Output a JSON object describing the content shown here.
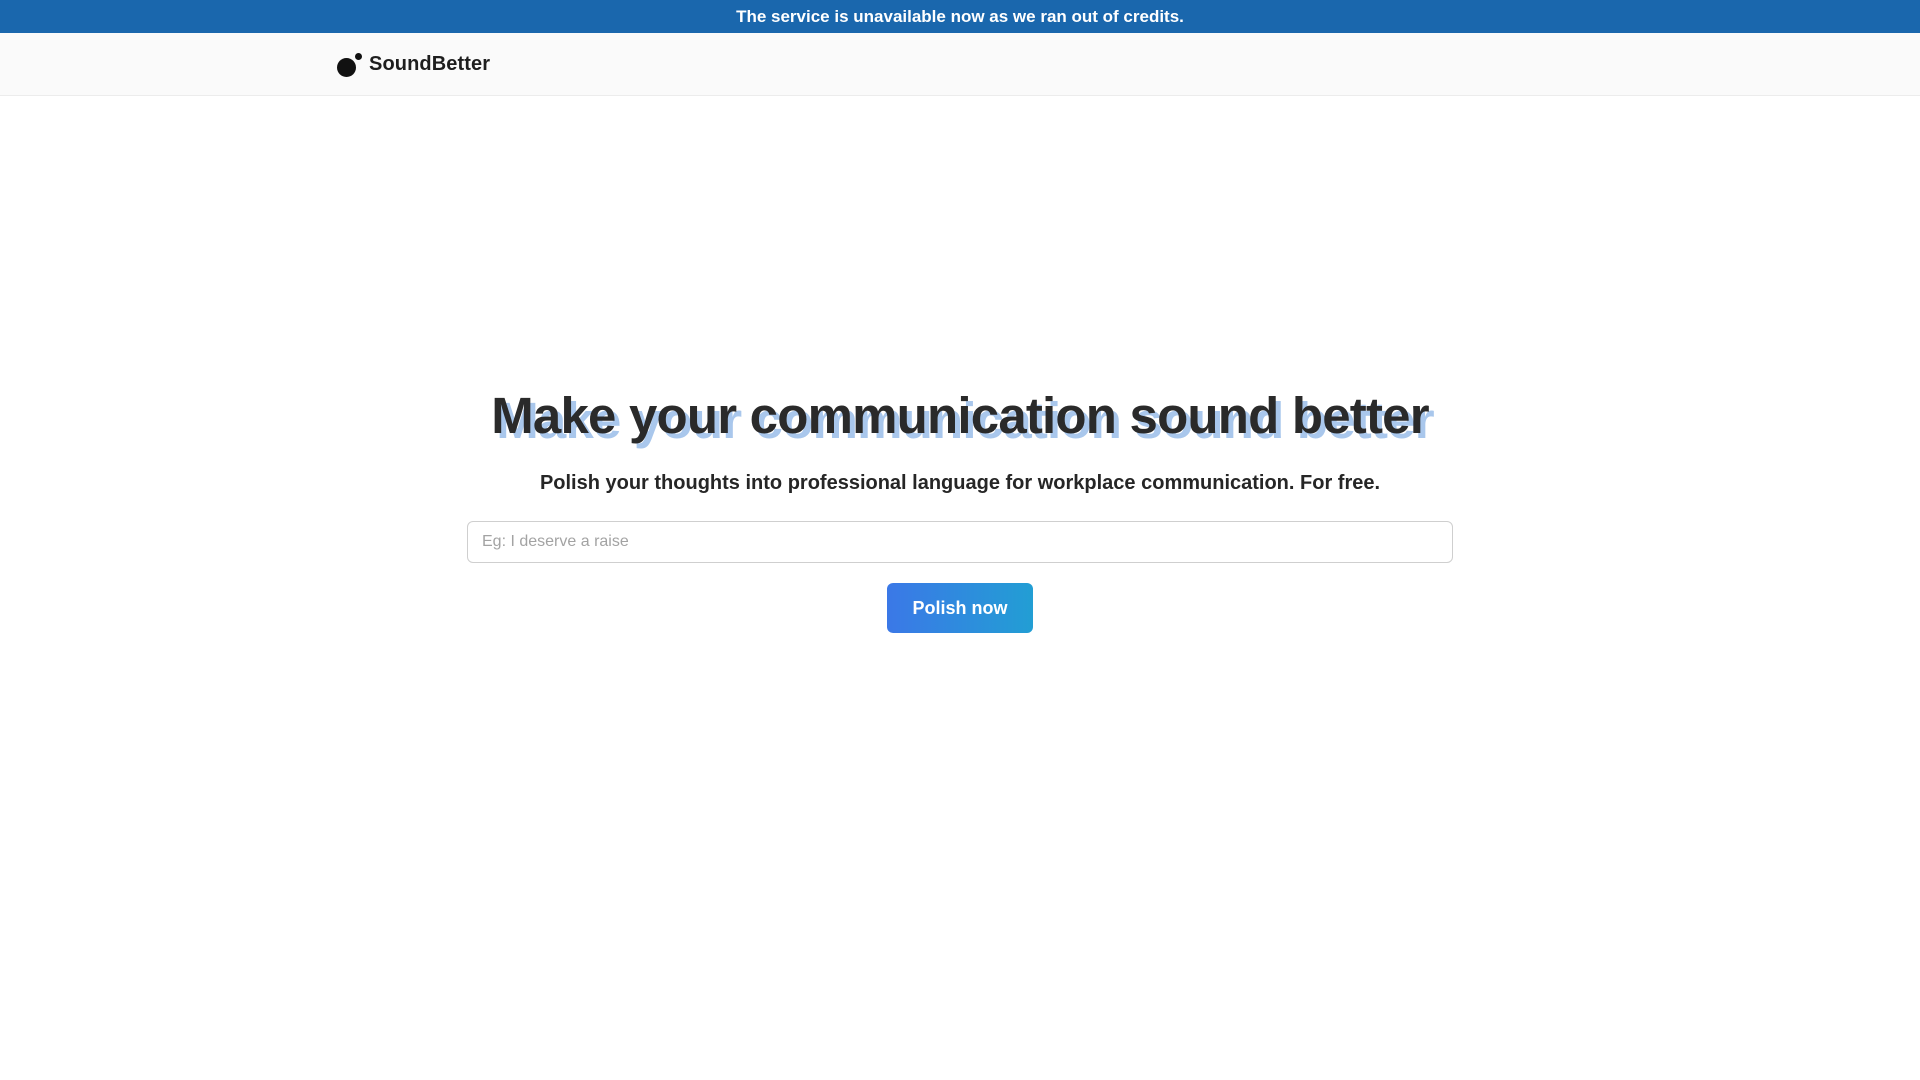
{
  "banner": {
    "message": "The service is unavailable now as we ran out of credits.",
    "color": "#1a67ad"
  },
  "header": {
    "brand_name": "SoundBetter",
    "logo_icon": "two-dots-logo-icon"
  },
  "hero": {
    "title": "Make your communication sound better",
    "title_shadow_color": "#a9c7ec",
    "subtitle": "Polish your thoughts into professional language for workplace communication. For free."
  },
  "form": {
    "input_value": "",
    "input_placeholder": "Eg: I deserve a raise",
    "submit_label": "Polish now",
    "button_gradient": [
      "#3b78e7",
      "#229ed4"
    ]
  }
}
